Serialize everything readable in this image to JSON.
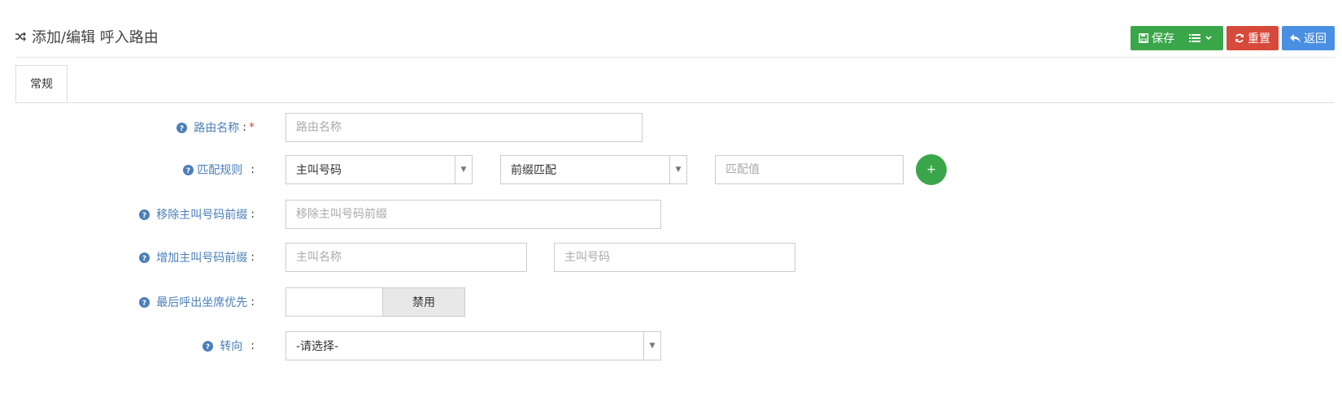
{
  "header": {
    "title": "添加/编辑 呼入路由",
    "title_icon": "random-icon",
    "buttons": {
      "save": "保存",
      "reset": "重置",
      "back": "返回"
    }
  },
  "colors": {
    "green": "#3aa64a",
    "red": "#d64a3b",
    "blue": "#4a90e2",
    "label": "#4a7fb8"
  },
  "tabs": [
    {
      "label": "常规",
      "active": true
    }
  ],
  "form": {
    "route_name": {
      "label": "路由名称",
      "colon": ":",
      "required_mark": "*",
      "value": "",
      "placeholder": "路由名称"
    },
    "match_rule": {
      "label": "匹配规则",
      "colon": ":",
      "field_select": "主叫号码",
      "mode_select": "前缀匹配",
      "value_placeholder": "匹配值",
      "add_label": "+"
    },
    "remove_prefix": {
      "label": "移除主叫号码前缀",
      "colon": ":",
      "placeholder": "移除主叫号码前缀"
    },
    "add_prefix": {
      "label": "增加主叫号码前缀",
      "colon": ":",
      "name_placeholder": "主叫名称",
      "number_placeholder": "主叫号码"
    },
    "last_agent_first": {
      "label": "最后呼出坐席优先",
      "colon": ":",
      "state": "禁用"
    },
    "transfer": {
      "label": "转向",
      "colon": ":",
      "selected": "-请选择-"
    }
  }
}
